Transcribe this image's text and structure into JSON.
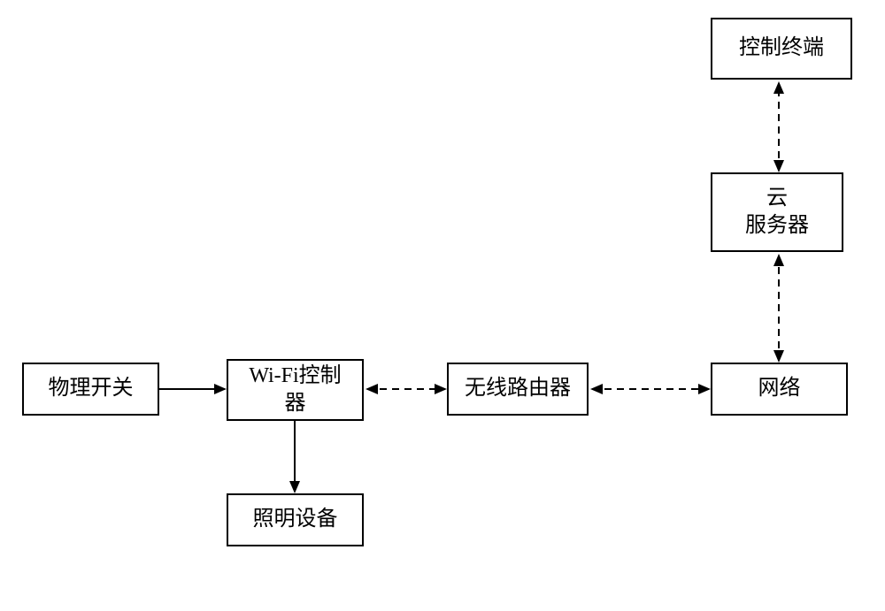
{
  "diagram": {
    "boxes": {
      "physical_switch": "物理开关",
      "wifi_controller": "Wi-Fi控制\n器",
      "wireless_router": "无线路由器",
      "network": "网络",
      "lighting_device": "照明设备",
      "cloud_server": "云\n服务器",
      "control_terminal": "控制终端"
    }
  }
}
